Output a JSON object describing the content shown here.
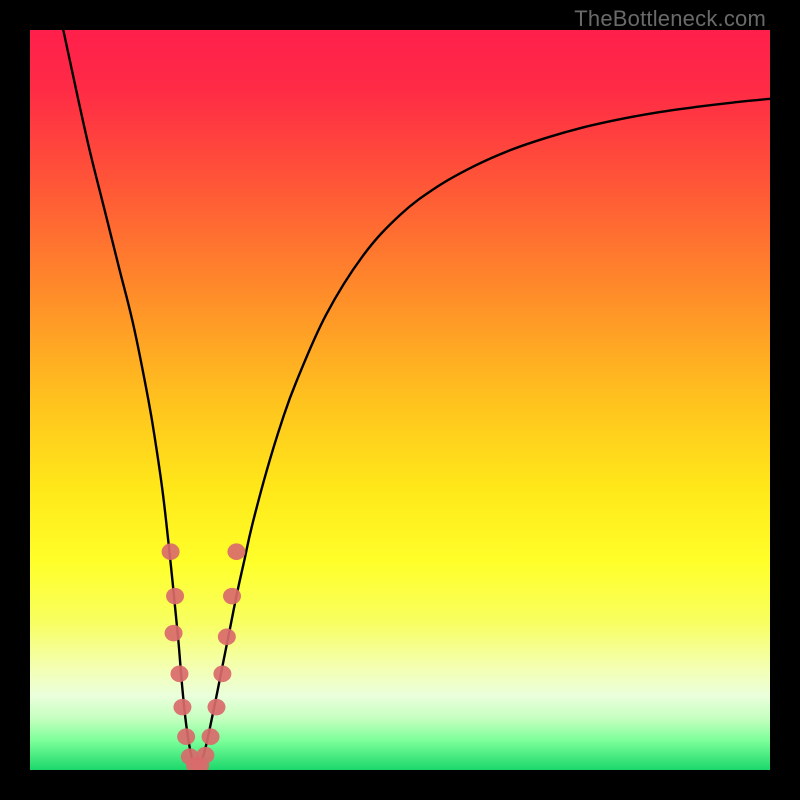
{
  "watermark": "TheBottleneck.com",
  "colors": {
    "frame": "#000000",
    "curve": "#000000",
    "marker_fill": "#d96a6b",
    "gradient_stops": [
      {
        "offset": 0.0,
        "color": "#ff1f4b"
      },
      {
        "offset": 0.08,
        "color": "#ff2b46"
      },
      {
        "offset": 0.2,
        "color": "#ff5338"
      },
      {
        "offset": 0.35,
        "color": "#ff8a2a"
      },
      {
        "offset": 0.5,
        "color": "#ffc21e"
      },
      {
        "offset": 0.62,
        "color": "#ffe81a"
      },
      {
        "offset": 0.72,
        "color": "#ffff2a"
      },
      {
        "offset": 0.8,
        "color": "#f8ff60"
      },
      {
        "offset": 0.86,
        "color": "#f4ffb0"
      },
      {
        "offset": 0.9,
        "color": "#eaffdc"
      },
      {
        "offset": 0.93,
        "color": "#c6ffc0"
      },
      {
        "offset": 0.96,
        "color": "#7dff9a"
      },
      {
        "offset": 1.0,
        "color": "#1bd86b"
      }
    ]
  },
  "chart_data": {
    "type": "line",
    "title": "",
    "xlabel": "",
    "ylabel": "",
    "xlim": [
      0,
      100
    ],
    "ylim": [
      0,
      100
    ],
    "x": [
      4.5,
      6,
      8,
      10,
      12,
      14,
      16,
      17,
      18,
      19,
      20,
      20.5,
      21,
      21.5,
      22,
      22.5,
      23,
      23.5,
      24,
      25,
      26,
      27,
      28,
      29,
      30,
      32,
      34,
      36,
      40,
      45,
      50,
      55,
      60,
      65,
      70,
      75,
      80,
      85,
      90,
      95,
      100
    ],
    "y": [
      100,
      93,
      84,
      76,
      68,
      60,
      50,
      44,
      37,
      28,
      18,
      12,
      7,
      3.5,
      1.2,
      0.4,
      0.8,
      2.2,
      4.2,
      9,
      14,
      19,
      24,
      28.5,
      33,
      40.5,
      47,
      52.5,
      61.5,
      69.5,
      75,
      78.8,
      81.6,
      83.8,
      85.5,
      86.9,
      88,
      88.9,
      89.6,
      90.2,
      90.7
    ],
    "markers": [
      {
        "x": 19.0,
        "y": 29.5
      },
      {
        "x": 19.6,
        "y": 23.5
      },
      {
        "x": 19.4,
        "y": 18.5
      },
      {
        "x": 20.2,
        "y": 13.0
      },
      {
        "x": 20.6,
        "y": 8.5
      },
      {
        "x": 21.1,
        "y": 4.5
      },
      {
        "x": 21.6,
        "y": 1.8
      },
      {
        "x": 22.3,
        "y": 0.6
      },
      {
        "x": 23.0,
        "y": 0.6
      },
      {
        "x": 23.7,
        "y": 2.0
      },
      {
        "x": 24.4,
        "y": 4.5
      },
      {
        "x": 25.2,
        "y": 8.5
      },
      {
        "x": 26.0,
        "y": 13.0
      },
      {
        "x": 26.6,
        "y": 18.0
      },
      {
        "x": 27.3,
        "y": 23.5
      },
      {
        "x": 27.9,
        "y": 29.5
      }
    ],
    "marker_radius_px": 9
  }
}
